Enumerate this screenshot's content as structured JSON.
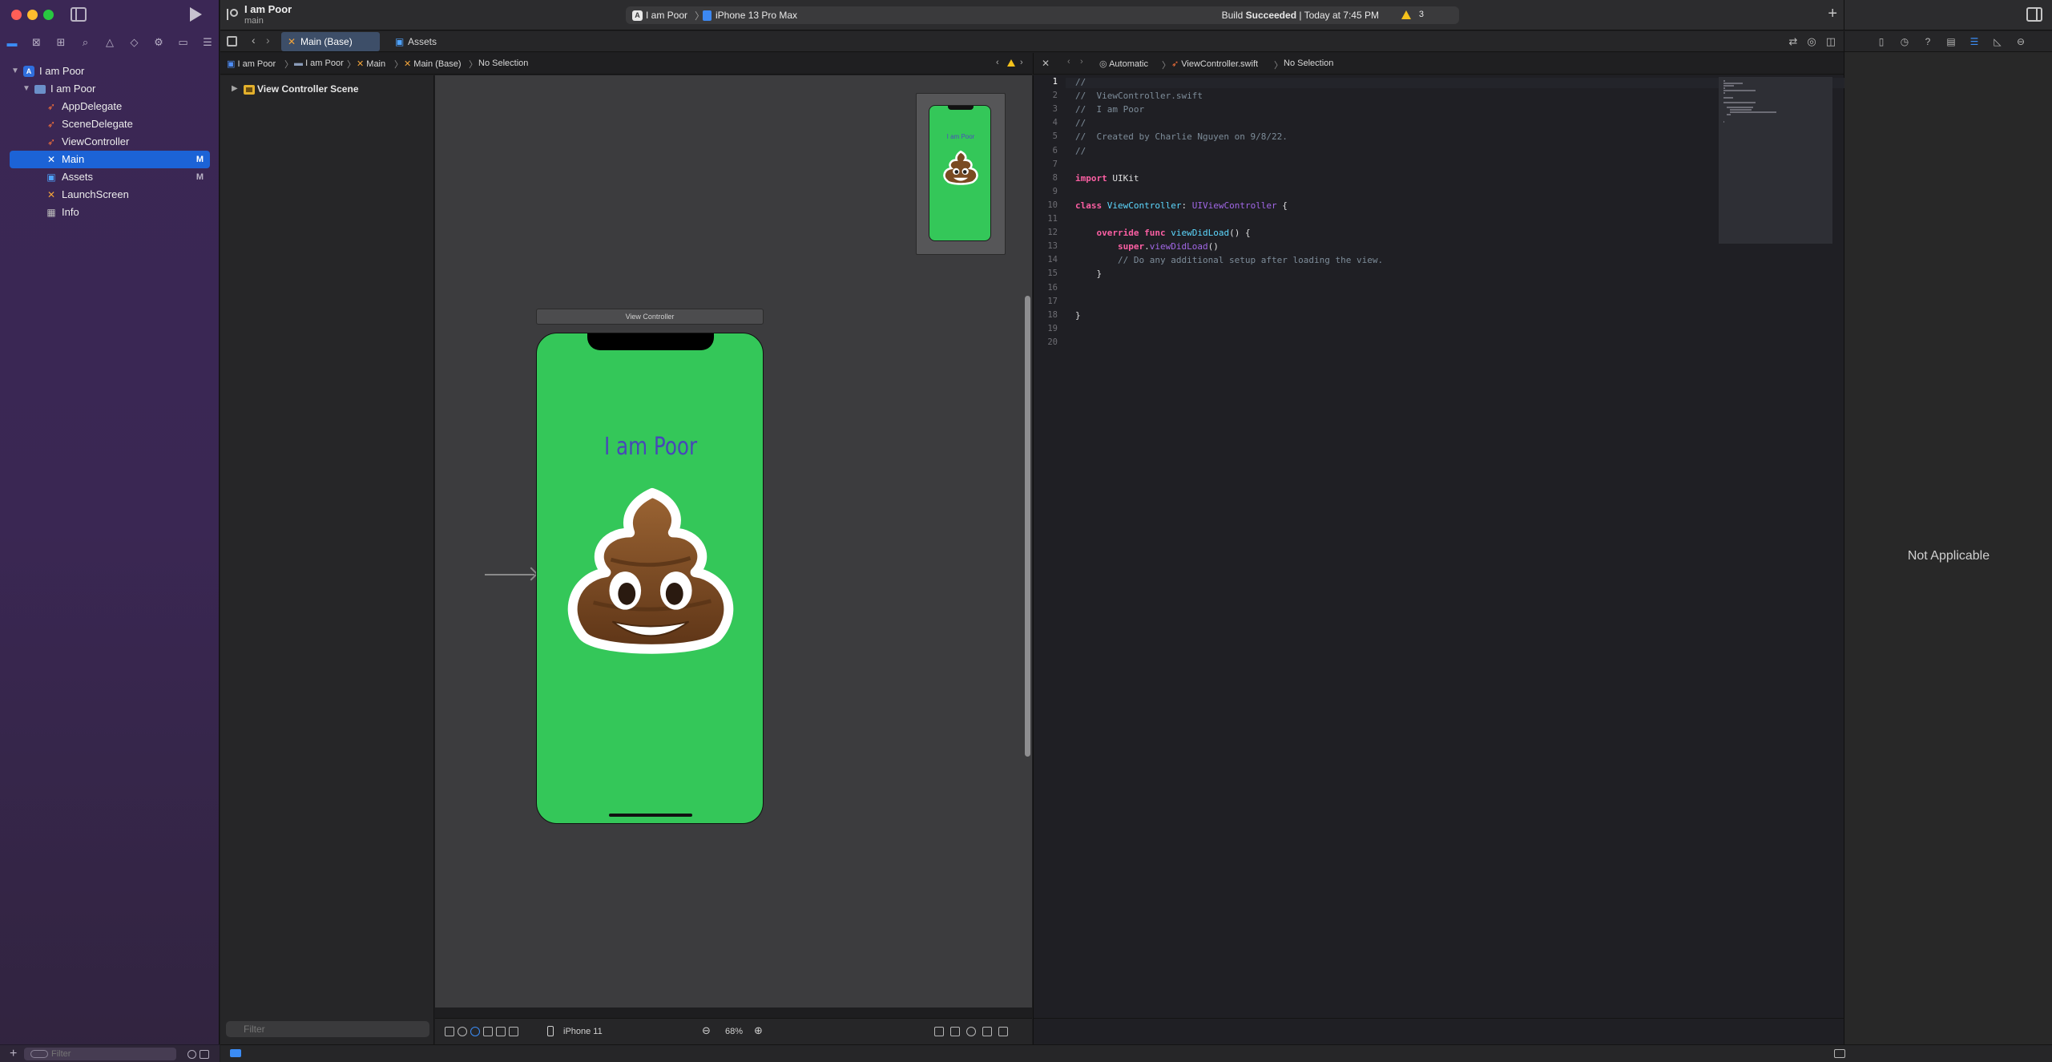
{
  "navigator": {
    "tabs": [
      "folder-icon",
      "source-control-icon",
      "symbol-icon",
      "find-icon",
      "issue-icon",
      "test-icon",
      "debug-icon",
      "breakpoint-icon",
      "report-icon"
    ],
    "items": [
      {
        "label": "I am Poor",
        "icon": "xcode-project-icon",
        "badge": ""
      },
      {
        "label": "I am Poor",
        "icon": "folder-icon",
        "badge": ""
      },
      {
        "label": "AppDelegate",
        "icon": "swift-file-icon",
        "badge": ""
      },
      {
        "label": "SceneDelegate",
        "icon": "swift-file-icon",
        "badge": ""
      },
      {
        "label": "ViewController",
        "icon": "swift-file-icon",
        "badge": ""
      },
      {
        "label": "Main",
        "icon": "storyboard-icon",
        "badge": "M"
      },
      {
        "label": "Assets",
        "icon": "asset-catalog-icon",
        "badge": "M"
      },
      {
        "label": "LaunchScreen",
        "icon": "storyboard-icon",
        "badge": ""
      },
      {
        "label": "Info",
        "icon": "plist-icon",
        "badge": ""
      }
    ],
    "filter_placeholder": "Filter"
  },
  "toolbar": {
    "project": "I am Poor",
    "branch": "main",
    "scheme": "I am Poor",
    "device": "iPhone 13 Pro Max",
    "status_prefix": "Build ",
    "status_bold": "Succeeded",
    "status_suffix": " | Today at 7:45 PM",
    "warning_count": "3"
  },
  "tabs": [
    {
      "label": "Main (Base)",
      "active": true
    },
    {
      "label": "Assets",
      "active": false
    }
  ],
  "jumpbar": {
    "crumbs": [
      "I am Poor",
      "I am Poor",
      "Main",
      "Main (Base)",
      "No Selection"
    ]
  },
  "code_jumpbar": {
    "crumbs": [
      "Automatic",
      "ViewController.swift",
      "No Selection"
    ]
  },
  "outline": {
    "scene": "View Controller Scene",
    "filter_placeholder": "Filter"
  },
  "canvas": {
    "scene_title": "View Controller",
    "app_title": "I am Poor",
    "device": "iPhone 11",
    "zoom": "68%",
    "colors": {
      "background": "#34c759",
      "label": "#4747b8"
    }
  },
  "editor": {
    "line_numbers": [
      "1",
      "2",
      "3",
      "4",
      "5",
      "6",
      "7",
      "8",
      "9",
      "10",
      "11",
      "12",
      "13",
      "14",
      "15",
      "16",
      "17",
      "18",
      "19",
      "20"
    ],
    "lines": [
      [
        {
          "t": "//",
          "c": "comment"
        }
      ],
      [
        {
          "t": "//  ViewController.swift",
          "c": "comment"
        }
      ],
      [
        {
          "t": "//  I am Poor",
          "c": "comment"
        }
      ],
      [
        {
          "t": "//",
          "c": "comment"
        }
      ],
      [
        {
          "t": "//  Created by Charlie Nguyen on 9/8/22.",
          "c": "comment"
        }
      ],
      [
        {
          "t": "//",
          "c": "comment"
        }
      ],
      [],
      [
        {
          "t": "import",
          "c": "kw"
        },
        {
          "t": " UIKit",
          "c": "plain"
        }
      ],
      [],
      [
        {
          "t": "class",
          "c": "kw"
        },
        {
          "t": " ",
          "c": "plain"
        },
        {
          "t": "ViewController",
          "c": "type"
        },
        {
          "t": ": ",
          "c": "plain"
        },
        {
          "t": "UIViewController",
          "c": "call"
        },
        {
          "t": " {",
          "c": "plain"
        }
      ],
      [],
      [
        {
          "t": "    ",
          "c": "plain"
        },
        {
          "t": "override",
          "c": "kw"
        },
        {
          "t": " ",
          "c": "plain"
        },
        {
          "t": "func",
          "c": "kw"
        },
        {
          "t": " ",
          "c": "plain"
        },
        {
          "t": "viewDidLoad",
          "c": "type"
        },
        {
          "t": "() {",
          "c": "plain"
        }
      ],
      [
        {
          "t": "        ",
          "c": "plain"
        },
        {
          "t": "super",
          "c": "kw"
        },
        {
          "t": ".",
          "c": "plain"
        },
        {
          "t": "viewDidLoad",
          "c": "call"
        },
        {
          "t": "()",
          "c": "plain"
        }
      ],
      [
        {
          "t": "        // Do any additional setup after loading the view.",
          "c": "comment"
        }
      ],
      [
        {
          "t": "    }",
          "c": "plain"
        }
      ],
      [],
      [],
      [
        {
          "t": "}",
          "c": "plain"
        }
      ],
      [],
      []
    ]
  },
  "inspector": {
    "tabs": [
      "file-icon",
      "history-icon",
      "help-icon",
      "identity-icon",
      "attributes-icon",
      "size-icon",
      "connections-icon"
    ],
    "message": "Not Applicable"
  }
}
